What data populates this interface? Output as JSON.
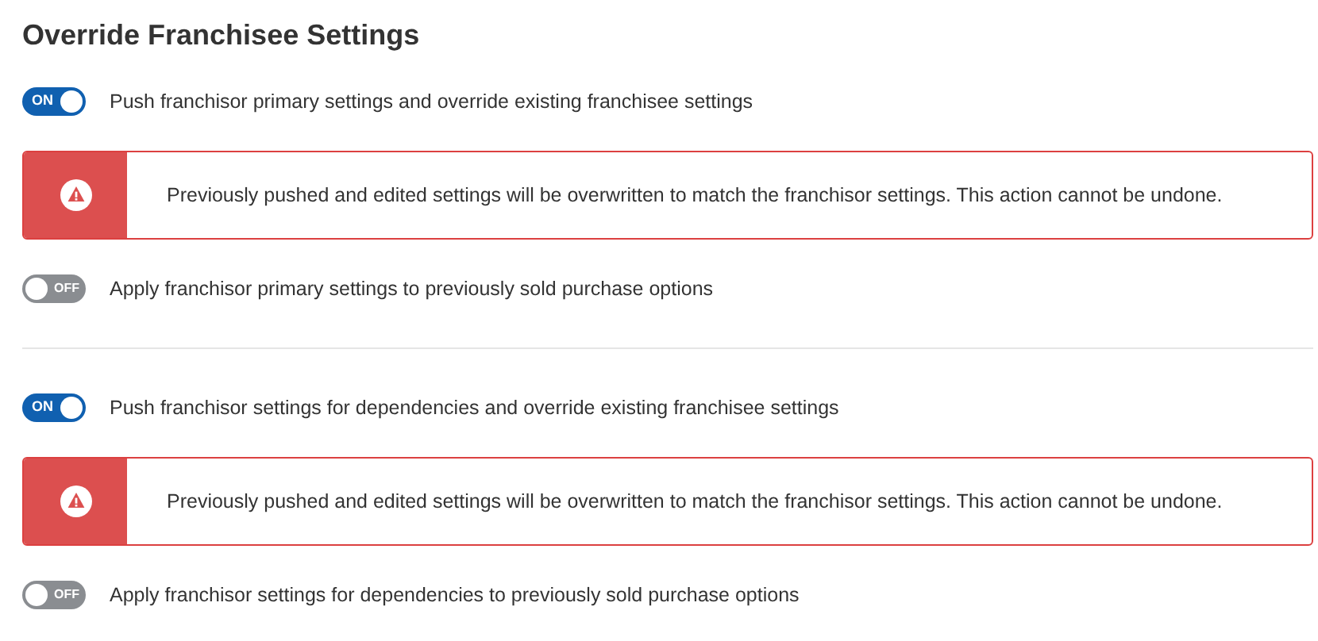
{
  "title": "Override Franchisee Settings",
  "sections": [
    {
      "items": [
        {
          "kind": "toggle",
          "on": true,
          "state_label": "ON",
          "label": "Push franchisor primary settings and override existing franchisee settings"
        },
        {
          "kind": "alert",
          "text": "Previously pushed and edited settings will be overwritten to match the franchisor settings. This action cannot be undone."
        },
        {
          "kind": "toggle",
          "on": false,
          "state_label": "OFF",
          "label": "Apply franchisor primary settings to previously sold purchase options"
        }
      ]
    },
    {
      "items": [
        {
          "kind": "toggle",
          "on": true,
          "state_label": "ON",
          "label": "Push franchisor settings for dependencies and override existing franchisee settings"
        },
        {
          "kind": "alert",
          "text": "Previously pushed and edited settings will be overwritten to match the franchisor settings. This action cannot be undone."
        },
        {
          "kind": "toggle",
          "on": false,
          "state_label": "OFF",
          "label": "Apply franchisor settings for dependencies to previously sold purchase options"
        }
      ]
    }
  ]
}
